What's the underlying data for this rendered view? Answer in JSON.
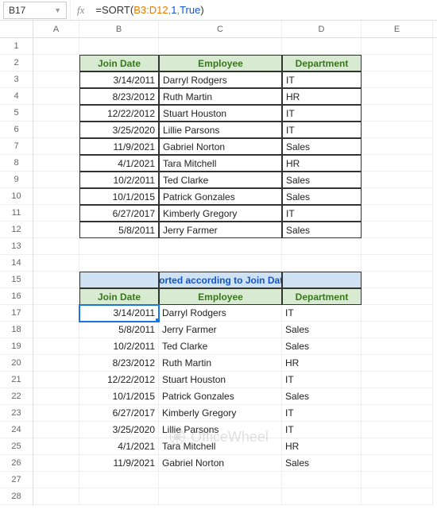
{
  "nameBox": "B17",
  "formula": {
    "eq": "=",
    "fn": "SORT",
    "open": "(",
    "ref": "B3:D12",
    "c1": ",",
    "arg1": "1",
    "c2": ",",
    "arg2": "True",
    "close": ")"
  },
  "columns": [
    "A",
    "B",
    "C",
    "D",
    "E"
  ],
  "rowCount": 28,
  "table1": {
    "headers": [
      "Join Date",
      "Employee",
      "Department"
    ],
    "rows": [
      [
        "3/14/2011",
        "Darryl Rodgers",
        "IT"
      ],
      [
        "8/23/2012",
        "Ruth Martin",
        "HR"
      ],
      [
        "12/22/2012",
        "Stuart Houston",
        "IT"
      ],
      [
        "3/25/2020",
        "Lillie Parsons",
        "IT"
      ],
      [
        "11/9/2021",
        "Gabriel Norton",
        "Sales"
      ],
      [
        "4/1/2021",
        "Tara Mitchell",
        "HR"
      ],
      [
        "10/2/2011",
        "Ted Clarke",
        "Sales"
      ],
      [
        "10/1/2015",
        "Patrick Gonzales",
        "Sales"
      ],
      [
        "6/27/2017",
        "Kimberly Gregory",
        "IT"
      ],
      [
        "5/8/2011",
        "Jerry Farmer",
        "Sales"
      ]
    ]
  },
  "table2": {
    "title": "Sorted according to Join Date",
    "headers": [
      "Join Date",
      "Employee",
      "Department"
    ],
    "rows": [
      [
        "3/14/2011",
        "Darryl Rodgers",
        "IT"
      ],
      [
        "5/8/2011",
        "Jerry Farmer",
        "Sales"
      ],
      [
        "10/2/2011",
        "Ted Clarke",
        "Sales"
      ],
      [
        "8/23/2012",
        "Ruth Martin",
        "HR"
      ],
      [
        "12/22/2012",
        "Stuart Houston",
        "IT"
      ],
      [
        "10/1/2015",
        "Patrick Gonzales",
        "Sales"
      ],
      [
        "6/27/2017",
        "Kimberly Gregory",
        "IT"
      ],
      [
        "3/25/2020",
        "Lillie Parsons",
        "IT"
      ],
      [
        "4/1/2021",
        "Tara Mitchell",
        "HR"
      ],
      [
        "11/9/2021",
        "Gabriel Norton",
        "Sales"
      ]
    ]
  },
  "watermark": "OfficeWheel"
}
